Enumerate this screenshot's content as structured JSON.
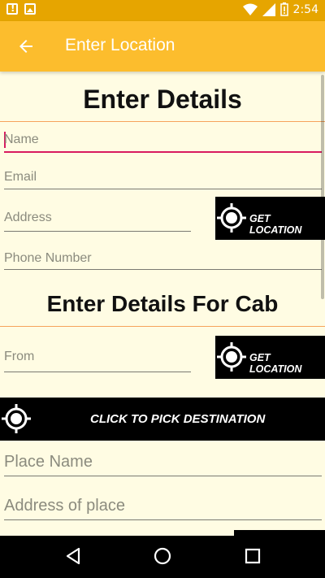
{
  "status_bar": {
    "time": "2:54"
  },
  "app_bar": {
    "title": "Enter Location",
    "back_icon": "arrow-back-icon"
  },
  "details": {
    "heading": "Enter Details",
    "name_label": "Name",
    "email_label": "Email",
    "address_label": "Address",
    "phone_label": "Phone Number",
    "get_location_label": "GET LOCATION"
  },
  "cab": {
    "heading": "Enter Details For Cab",
    "from_label": "From",
    "get_location_label": "GET LOCATION",
    "pick_destination_label": "CLICK TO PICK DESTINATION",
    "place_name_label": "Place Name",
    "address_of_place_label": "Address of place"
  },
  "colors": {
    "status_bar": "#E6A500",
    "app_bar": "#FCBD2D",
    "background": "#FFFCE3",
    "accent": "#D81B60",
    "divider": "#F6A35C"
  }
}
